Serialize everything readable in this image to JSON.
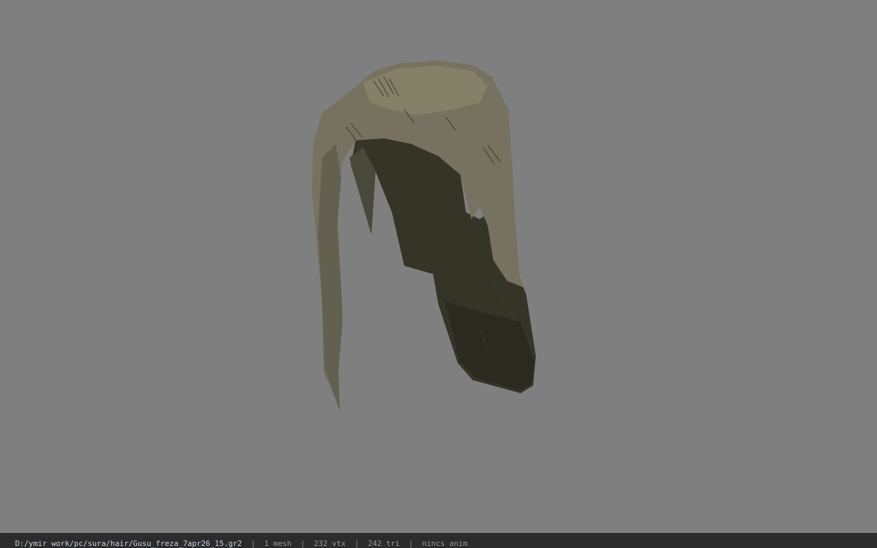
{
  "viewer": {
    "background_color": "#7f7f7f",
    "model": {
      "name": "hair-mesh",
      "colors": {
        "outer": "#77725f",
        "outer_shade": "#5f5b4a",
        "inner": "#363427",
        "inner_dark": "#2a2920"
      }
    }
  },
  "status": {
    "file_path": "D:/ymir work/pc/sura/hair/Gusu_freza_7apr26_15.gr2",
    "mesh_count": "1 mesh",
    "vertex_count": "232 vtx",
    "triangle_count": "242 tri",
    "anim_status": "nincs anim",
    "separator": "|"
  }
}
